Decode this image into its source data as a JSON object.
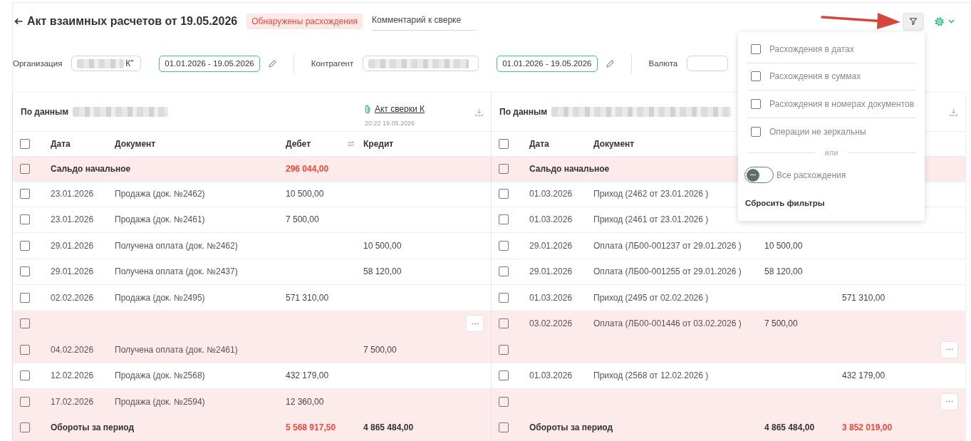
{
  "header": {
    "title": "Акт взаимных расчетов от 19.05.2026",
    "status_badge": "Обнаружены расхождения",
    "comment_field": {
      "placeholder": "Комментарий к сверке"
    }
  },
  "toolbar": {
    "filter_button": {
      "expanded": true
    }
  },
  "filter_bar": [
    {
      "kind": "party",
      "label": "Организация",
      "redacted": true,
      "value": "К\""
    },
    {
      "kind": "period",
      "value": "01.01.2026 - 19.05.2026"
    },
    {
      "kind": "party",
      "label": "Контрагент",
      "redacted": true
    },
    {
      "kind": "period",
      "value": "01.01.2026 - 19.05.2026"
    },
    {
      "kind": "party",
      "label": "Валюта"
    }
  ],
  "filter_menu": {
    "options": [
      {
        "label": "Расхождения в датах",
        "checked": false
      },
      {
        "label": "Расхождения в суммах",
        "checked": false
      },
      {
        "label": "Расхождения в номерах документов",
        "checked": false
      },
      {
        "label": "Операции не зеркальны",
        "checked": false
      }
    ],
    "separator_label": "или",
    "all_toggle": {
      "label": "Все расхождения",
      "on": false
    },
    "reset": "Сбросить фильтры"
  },
  "panels": [
    {
      "source_label": "По данным",
      "redacted": true,
      "attachment": {
        "name": "Акт сверки К",
        "timestamp": "20:22 19.05.2026"
      },
      "select_all": {
        "checked": false
      },
      "columns": [
        "Дата",
        "Документ",
        "Дебет",
        "Кредит"
      ],
      "rows": [
        {
          "kind": "summary",
          "label": "Сальдо начальное",
          "debit": "296 044,00",
          "debit_alert": true,
          "checked": false,
          "mismatch": true
        },
        {
          "kind": "entry",
          "date": "23.01.2026",
          "document": "Продажа (док. №2462)",
          "debit": "10 500,00",
          "checked": false,
          "mismatch": false
        },
        {
          "kind": "entry",
          "date": "23.01.2026",
          "document": "Продажа (док. №2461)",
          "debit": "7 500,00",
          "checked": false,
          "mismatch": false
        },
        {
          "kind": "entry",
          "date": "29.01.2026",
          "document": "Получена оплата (док. №2462)",
          "credit": "10 500,00",
          "checked": false,
          "mismatch": false
        },
        {
          "kind": "entry",
          "date": "29.01.2026",
          "document": "Получена оплата (док. №2437)",
          "credit": "58 120,00",
          "checked": false,
          "mismatch": false
        },
        {
          "kind": "entry",
          "date": "02.02.2026",
          "document": "Продажа (док. №2495)",
          "debit": "571 310,00",
          "checked": false,
          "mismatch": false
        },
        {
          "kind": "blank",
          "checked": false,
          "mismatch": true
        },
        {
          "kind": "entry",
          "date": "04.02.2026",
          "document": "Получена оплата (док. №2461)",
          "credit": "7 500,00",
          "checked": false,
          "mismatch": true
        },
        {
          "kind": "entry",
          "date": "12.02.2026",
          "document": "Продажа (док. №2568)",
          "debit": "432 179,00",
          "checked": false,
          "mismatch": false
        },
        {
          "kind": "entry",
          "date": "17.02.2026",
          "document": "Продажа (док. №2594)",
          "debit": "12 360,00",
          "checked": false,
          "mismatch": true
        },
        {
          "kind": "summary",
          "label": "Обороты за период",
          "debit": "5 568 917,50",
          "credit": "4 865 484,00",
          "debit_alert": true,
          "credit_alert": false,
          "checked": false,
          "mismatch": true
        }
      ]
    },
    {
      "source_label": "По данным",
      "redacted": true,
      "select_all": {
        "checked": false
      },
      "columns": [
        "Дата",
        "Документ"
      ],
      "rows": [
        {
          "kind": "summary",
          "label": "Сальдо начальное",
          "checked": false,
          "mismatch": true
        },
        {
          "kind": "entry",
          "date": "01.03.2026",
          "document": "Приход (2462 от 23.01.2026 )",
          "checked": false,
          "mismatch": false
        },
        {
          "kind": "entry",
          "date": "01.03.2026",
          "document": "Приход (2461 от 23.01.2026 )",
          "checked": false,
          "mismatch": false
        },
        {
          "kind": "entry",
          "date": "29.01.2026",
          "document": "Оплата (ЛБ00-001237 от 29.01.2026 )",
          "debit": "10 500,00",
          "checked": false,
          "mismatch": false
        },
        {
          "kind": "entry",
          "date": "29.01.2026",
          "document": "Оплата (ЛБ00-001255 от 29.01.2026 )",
          "debit": "58 120,00",
          "checked": false,
          "mismatch": false
        },
        {
          "kind": "entry",
          "date": "01.03.2026",
          "document": "Приход (2495 от 02.02.2026 )",
          "credit": "571 310,00",
          "checked": false,
          "mismatch": false
        },
        {
          "kind": "entry",
          "date": "03.02.2026",
          "document": "Оплата (ЛБ00-001446 от 03.02.2026 )",
          "debit": "7 500,00",
          "checked": false,
          "mismatch": true
        },
        {
          "kind": "blank",
          "checked": false,
          "mismatch": true
        },
        {
          "kind": "entry",
          "date": "01.03.2026",
          "document": "Приход (2568 от 12.02.2026 )",
          "credit": "432 179,00",
          "checked": false,
          "mismatch": false
        },
        {
          "kind": "blank",
          "checked": false,
          "mismatch": true
        },
        {
          "kind": "summary",
          "label": "Обороты за период",
          "debit": "4 865 484,00",
          "credit": "3 852 019,00",
          "debit_alert": false,
          "credit_alert": true,
          "checked": false,
          "mismatch": true
        }
      ]
    }
  ]
}
